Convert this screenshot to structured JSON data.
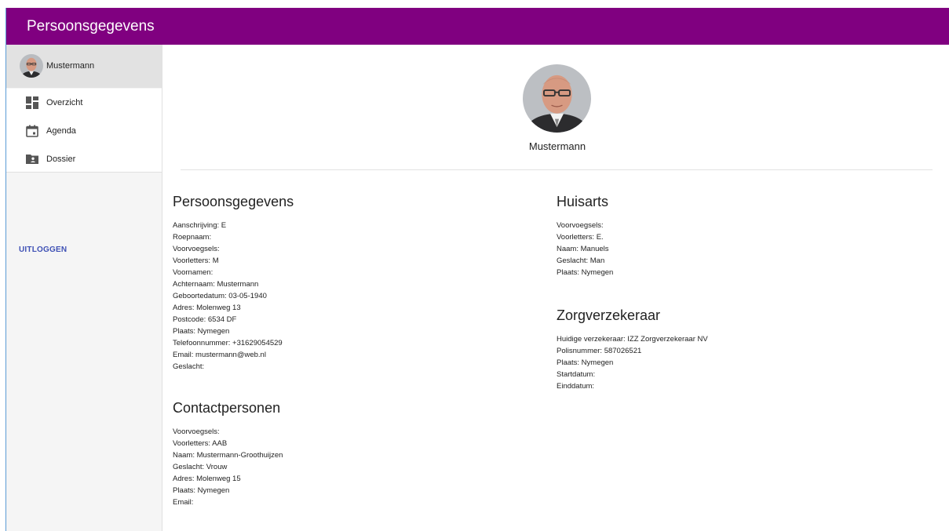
{
  "app": {
    "title": "Persoonsgegevens"
  },
  "sidebar": {
    "user": "Mustermann",
    "items": [
      {
        "label": "Overzicht",
        "icon": "dashboard-icon"
      },
      {
        "label": "Agenda",
        "icon": "calendar-icon"
      },
      {
        "label": "Dossier",
        "icon": "folder-account-icon"
      }
    ],
    "logout": "UITLOGGEN"
  },
  "profile": {
    "name": "Mustermann"
  },
  "sections": {
    "persoonsgegevens": {
      "title": "Persoonsgegevens",
      "lines": [
        "Aanschrijving: E",
        "Roepnaam:",
        "Voorvoegsels:",
        "Voorletters: M",
        "Voornamen:",
        "Achternaam: Mustermann",
        "Geboortedatum: 03-05-1940",
        "Adres: Molenweg 13",
        "Postcode: 6534 DF",
        "Plaats: Nymegen",
        "Telefoonnummer: +31629054529",
        "Email: mustermann@web.nl",
        "Geslacht:"
      ]
    },
    "huisarts": {
      "title": "Huisarts",
      "lines": [
        "Voorvoegsels:",
        "Voorletters: E.",
        "Naam: Manuels",
        "Geslacht: Man",
        "Plaats: Nymegen"
      ]
    },
    "zorgverzekeraar": {
      "title": "Zorgverzekeraar",
      "lines": [
        "Huidige verzekeraar: IZZ Zorgverzekeraar NV",
        "Polisnummer: 587026521",
        "Plaats: Nymegen",
        "Startdatum:",
        "Einddatum:"
      ]
    },
    "contactpersonen": {
      "title": "Contactpersonen",
      "lines": [
        "Voorvoegsels:",
        "Voorletters: AAB",
        "Naam: Mustermann-Groothuijzen",
        "Geslacht: Vrouw",
        "Adres: Molenweg 15",
        "Plaats: Nymegen",
        "Email:"
      ]
    }
  },
  "colors": {
    "header": "#800080",
    "logout": "#3f51b5",
    "icon": "#555555"
  }
}
